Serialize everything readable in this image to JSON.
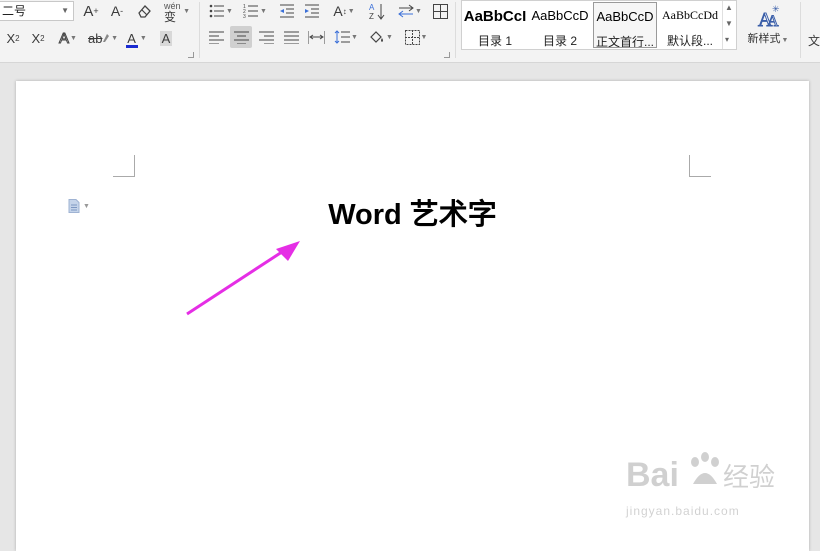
{
  "ribbon": {
    "font_size": {
      "value": "二号"
    },
    "buttons": {
      "grow_font": "A",
      "shrink_font": "A",
      "clear_format": "◇",
      "phonetic": "wén",
      "superscript": "X",
      "subscript": "X",
      "text_effect": "A",
      "highlight": "ab",
      "font_color": "A",
      "char_shading": "A",
      "sort": "A↓"
    },
    "styles": [
      {
        "sample": "AaBbCcI",
        "name": "目录 1"
      },
      {
        "sample": "AaBbCcD",
        "name": "目录 2"
      },
      {
        "sample": "AaBbCcD",
        "name": "正文首行..."
      },
      {
        "sample": "AaBbCcDd",
        "name": "默认段..."
      }
    ],
    "new_style": {
      "label": "新样式"
    },
    "partial_label": "文"
  },
  "document": {
    "title": "Word 艺术字"
  },
  "watermark": {
    "brand": "Bai 经验",
    "url": "jingyan.baidu.com"
  },
  "colors": {
    "arrow": "#e52ee5",
    "font_color_bar": "#1a2bd1",
    "page": "#ffffff",
    "workspace": "#e6e6e6"
  }
}
